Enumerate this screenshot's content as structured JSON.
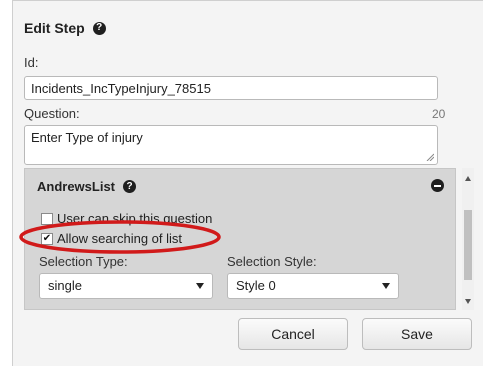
{
  "dialog": {
    "title": "Edit Step",
    "help_icon": "?"
  },
  "fields": {
    "id_label": "Id:",
    "id_value": "Incidents_IncTypeInjury_78515",
    "question_label": "Question:",
    "question_counter": "20",
    "question_value": "Enter Type of injury"
  },
  "panel": {
    "title": "AndrewsList",
    "help_icon": "?",
    "checkboxes": [
      {
        "label": "User can skip this question",
        "checked": false
      },
      {
        "label": "Allow searching of list",
        "checked": true
      }
    ],
    "selection_type_label": "Selection Type:",
    "selection_type_value": "single",
    "selection_style_label": "Selection Style:",
    "selection_style_value": "Style 0"
  },
  "buttons": {
    "cancel": "Cancel",
    "save": "Save"
  },
  "colors": {
    "annotation": "#d11a1a",
    "panel_bg": "#d6d6d6"
  }
}
